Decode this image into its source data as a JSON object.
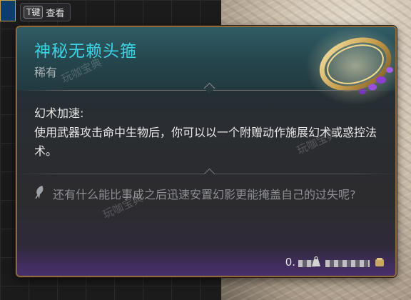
{
  "hud": {
    "key": "T键",
    "action": "查看"
  },
  "item": {
    "name": "神秘无赖头箍",
    "rarity": "稀有",
    "effect_name": "幻术加速:",
    "effect_desc": "使用武器攻击命中生物后，你可以以一个附赠动作施展幻术或惑控法术。",
    "flavor": "还有什么能比事成之后迅速安置幻影更能掩盖自己的过失呢?",
    "weight": "0."
  },
  "watermark": "玩咖宝典",
  "colors": {
    "title": "#3bd2e6",
    "border": "#8f6a3c",
    "ring_gold": "#d8b45a",
    "gem_purple": "#8b3fd0"
  }
}
